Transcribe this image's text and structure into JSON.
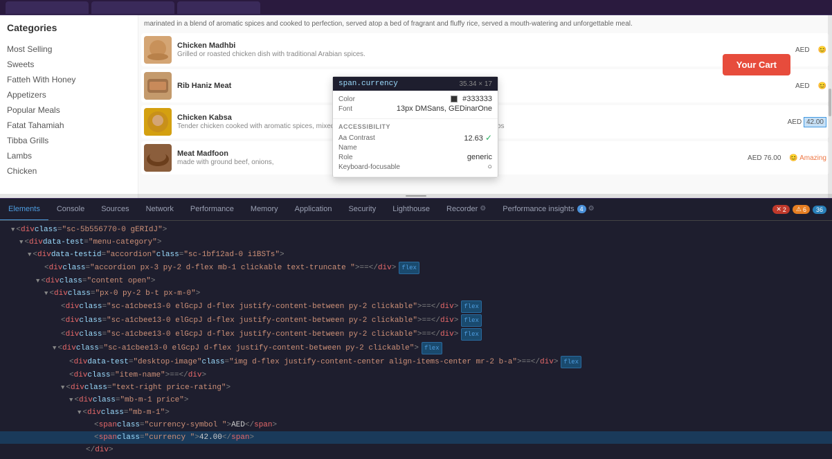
{
  "browser": {
    "chrome_height": 22
  },
  "preview": {
    "cart_button": "Your Cart",
    "categories_title": "Categories",
    "sidebar_items": [
      "Most Selling",
      "Sweets",
      "Fatteh With Honey",
      "Appetizers",
      "Popular Meals",
      "Fatat Tahamiah",
      "Tibba Grills",
      "Lambs",
      "Chicken"
    ],
    "food_items": [
      {
        "name": "Chicken Madhbi",
        "desc": "Grilled or roasted chicken dish with traditional Arabian spices.",
        "price": "AED"
      },
      {
        "name": "Rib Haniz Meat",
        "desc": "",
        "price": "AED"
      },
      {
        "name": "Chicken Kabsa",
        "desc": "Tender chicken cooked with aromatic spices, mixed with long-grain rice, and garnished with nuts and herbs",
        "price": "AED"
      },
      {
        "name": "Meat Madfoon",
        "desc": "made with ground beef, onions,",
        "price": "AED 76.00"
      }
    ]
  },
  "tooltip": {
    "element": "span.currency",
    "dims": "35.34 × 17",
    "color_label": "Color",
    "color_value": "#333333",
    "font_label": "Font",
    "font_value": "13px DMSans, GEDinarOne",
    "accessibility_title": "ACCESSIBILITY",
    "contrast_label": "Contrast",
    "contrast_value": "12.63",
    "contrast_pass": "✓",
    "name_label": "Name",
    "name_value": "",
    "role_label": "Role",
    "role_value": "generic",
    "keyboard_label": "Keyboard-focusable",
    "keyboard_value": "○"
  },
  "tabs": {
    "items": [
      {
        "label": "Elements",
        "active": true
      },
      {
        "label": "Console",
        "active": false
      },
      {
        "label": "Sources",
        "active": false
      },
      {
        "label": "Network",
        "active": false
      },
      {
        "label": "Performance",
        "active": false
      },
      {
        "label": "Memory",
        "active": false
      },
      {
        "label": "Application",
        "active": false
      },
      {
        "label": "Security",
        "active": false
      },
      {
        "label": "Lighthouse",
        "active": false
      },
      {
        "label": "Recorder",
        "active": false
      },
      {
        "label": "Performance insights",
        "badge": "4",
        "active": false
      }
    ],
    "error_count": "2",
    "warn_count": "6",
    "info_count": "36"
  },
  "dom": {
    "lines": [
      {
        "indent": 2,
        "arrow": "open",
        "content": "<div class=\"sc-5b556770-0 gERIdJ\">"
      },
      {
        "indent": 3,
        "arrow": "open",
        "content": "<div data-test=\"menu-category\">"
      },
      {
        "indent": 4,
        "arrow": "open",
        "content": "<div data-testid=\"accordion\" class=\"sc-1bf12ad-0 i1BSTs\">"
      },
      {
        "indent": 5,
        "arrow": "leaf",
        "content": "<div class=\"accordion px-3 py-2 d-flex mb-1 clickable text-truncate \"> == </div>",
        "badge": "flex"
      },
      {
        "indent": 5,
        "arrow": "open",
        "content": "<div class=\"content open\">"
      },
      {
        "indent": 6,
        "arrow": "open",
        "content": "<div class=\"px-0 py-2 b-t px-m-0\">"
      },
      {
        "indent": 7,
        "arrow": "leaf",
        "content": "<div class=\"sc-a1cbee13-0 elGcpJ d-flex justify-content-between py-2 clickable\"> == </div>",
        "badge": "flex"
      },
      {
        "indent": 7,
        "arrow": "leaf",
        "content": "<div class=\"sc-a1cbee13-0 elGcpJ d-flex justify-content-between py-2 clickable\"> == </div>",
        "badge": "flex"
      },
      {
        "indent": 7,
        "arrow": "leaf",
        "content": "<div class=\"sc-a1cbee13-0 elGcpJ d-flex justify-content-between py-2 clickable\"> == </div>",
        "badge": "flex"
      },
      {
        "indent": 7,
        "arrow": "open",
        "content": "<div class=\"sc-a1cbee13-0 elGcpJ d-flex justify-content-between py-2 clickable\">",
        "badge": "flex"
      },
      {
        "indent": 8,
        "arrow": "leaf",
        "content": "<div data-test=\"desktop-image\" class=\"img d-flex justify-content-center align-items-center mr-2 b-a\"> == </div>",
        "badge": "flex"
      },
      {
        "indent": 8,
        "arrow": "leaf",
        "content": "<div class=\"item-name\"> == </div>"
      },
      {
        "indent": 8,
        "arrow": "open",
        "content": "<div class=\"text-right price-rating\">"
      },
      {
        "indent": 9,
        "arrow": "open",
        "content": "<div class=\"mb-m-1 price\">"
      },
      {
        "indent": 10,
        "arrow": "open",
        "content": "<div class=\"mb-m-1\">"
      },
      {
        "indent": 11,
        "arrow": "leaf",
        "content": "<span class=\"currency-symbol \">AED</span>"
      },
      {
        "indent": 11,
        "arrow": "leaf",
        "content": "<span class=\"currency \">42.00</span>",
        "selected": true
      },
      {
        "indent": 10,
        "arrow": "leaf",
        "content": "</div>"
      }
    ]
  },
  "status": {
    "text": ""
  }
}
